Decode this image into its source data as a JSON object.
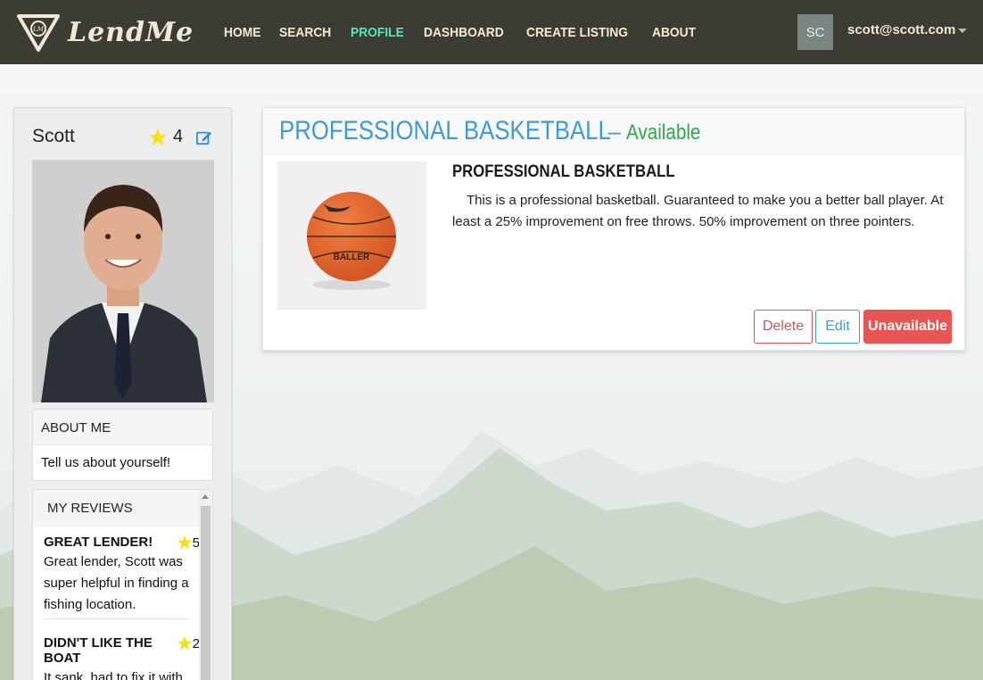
{
  "brand": {
    "name": "LendMe",
    "logo_mark": "LM"
  },
  "nav": {
    "items": [
      {
        "label": "HOME",
        "active": false
      },
      {
        "label": "SEARCH",
        "active": false
      },
      {
        "label": "PROFILE",
        "active": true
      },
      {
        "label": "DASHBOARD",
        "active": false
      },
      {
        "label": "CREATE LISTING",
        "active": false
      },
      {
        "label": "ABOUT",
        "active": false
      }
    ],
    "avatar_initials": "SC",
    "user_email": "scott@scott.com"
  },
  "profile": {
    "name": "Scott",
    "rating": "4",
    "about_header": "ABOUT ME",
    "about_text": "Tell us about yourself!",
    "reviews_header": "MY REVIEWS",
    "reviews": [
      {
        "title": "GREAT LENDER!",
        "stars": "5",
        "text": "Great lender, Scott was super helpful in finding a fishing location."
      },
      {
        "title": "DIDN'T LIKE THE BOAT",
        "stars": "2",
        "text": "It sank, had to fix it with"
      }
    ]
  },
  "listing": {
    "title": "PROFESSIONAL BASKETBALL",
    "separator": "–",
    "status": "Available",
    "item_name": "PROFESSIONAL BASKETBALL",
    "description": "This is a professional basketball. Guaranteed to make you a better ball player. At least a 25% improvement on free throws. 50% improvement on three pointers.",
    "image_text": "BALLER",
    "buttons": {
      "delete": "Delete",
      "edit": "Edit",
      "unavailable": "Unavailable"
    }
  },
  "colors": {
    "navbar": "#3b3c33",
    "nav_active": "#5be3b8",
    "title_blue": "#3d9bd6",
    "status_green": "#2fa84f",
    "danger": "#e85555"
  }
}
